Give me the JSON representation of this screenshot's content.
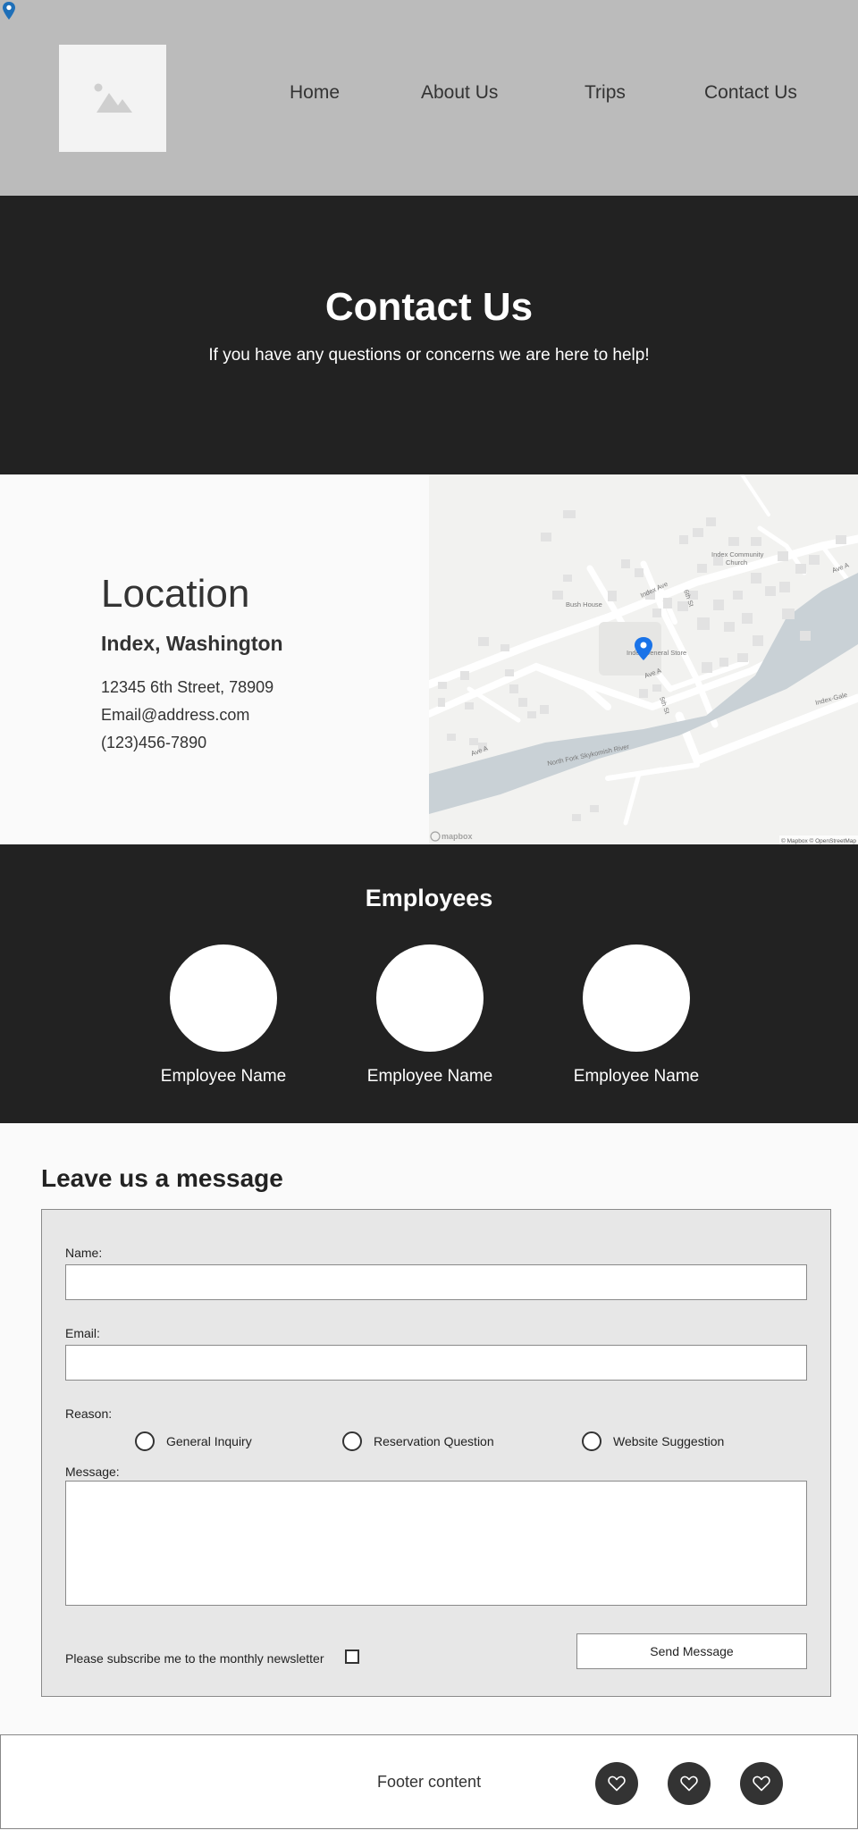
{
  "nav": {
    "items": [
      "Home",
      "About Us",
      "Trips",
      "Contact Us"
    ]
  },
  "hero": {
    "title": "Contact Us",
    "subtitle": "If you have any questions or concerns we are here to help!"
  },
  "location": {
    "heading": "Location",
    "city": "Index, Washington",
    "address": "12345 6th Street, 78909",
    "email": "Email@address.com",
    "phone": "(123)456-7890"
  },
  "map": {
    "labels": {
      "church": "Index Community",
      "church2": "Church",
      "bush_house": "Bush House",
      "index_ave": "Index Ave",
      "sixth_st": "6th St",
      "store": "Index General Store",
      "ave_a": "Ave A",
      "ave_a_right": "Ave A",
      "fifth_st": "5th St",
      "river": "North Fork Skykomish River",
      "ave_a_left": "Ave A",
      "index_galena": "Index-Gale",
      "attribution": "© Mapbox © OpenStreetMap",
      "brand": "mapbox"
    }
  },
  "employees": {
    "title": "Employees",
    "names": [
      "Employee Name",
      "Employee Name",
      "Employee Name"
    ]
  },
  "form": {
    "title": "Leave us a message",
    "name_label": "Name:",
    "email_label": "Email:",
    "reason_label": "Reason:",
    "reasons": [
      "General Inquiry",
      "Reservation Question",
      "Website Suggestion"
    ],
    "message_label": "Message:",
    "subscribe_label": "Please subscribe me to the monthly newsletter",
    "send_label": "Send Message"
  },
  "footer": {
    "text": "Footer content",
    "social_icons": [
      "heart-icon",
      "heart-icon",
      "heart-icon"
    ]
  },
  "colors": {
    "header_bg": "#bbbbbb",
    "dark_bg": "#222222",
    "form_bg": "#e7e7e7",
    "map_pin": "#1a73e8",
    "river": "#c9d1d6"
  }
}
